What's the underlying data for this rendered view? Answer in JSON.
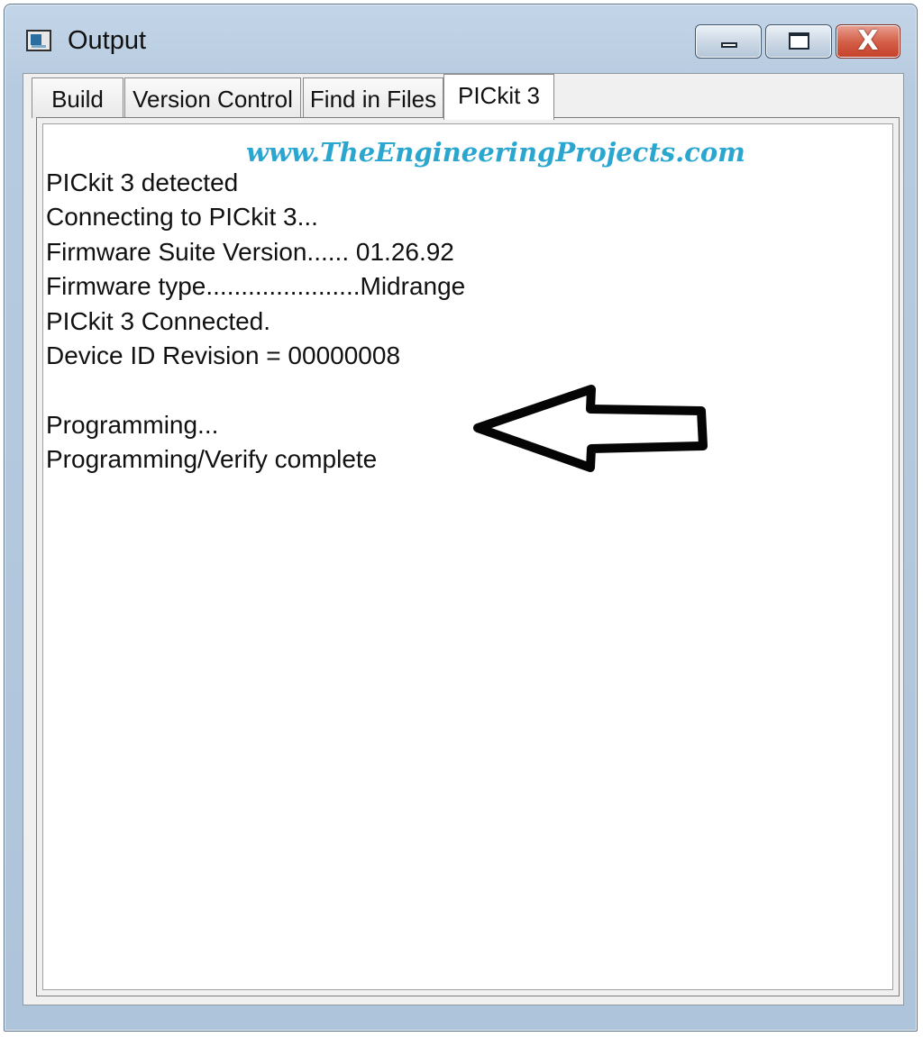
{
  "window": {
    "title": "Output",
    "icon": "output-window-icon"
  },
  "controls": {
    "minimize_icon": "minimize-icon",
    "maximize_icon": "maximize-icon",
    "close_glyph": "X"
  },
  "tabs": [
    {
      "label": "Build",
      "selected": false
    },
    {
      "label": "Version Control",
      "selected": false
    },
    {
      "label": "Find in Files",
      "selected": false
    },
    {
      "label": "PICkit 3",
      "selected": true
    }
  ],
  "content": {
    "watermark": "www.TheEngineeringProjects.com",
    "lines": [
      "PICkit 3 detected",
      "Connecting to PICkit 3...",
      "Firmware Suite Version...... 01.26.92",
      "Firmware type......................Midrange",
      "PICkit 3 Connected.",
      "Device ID Revision = 00000008",
      "",
      "Programming...",
      "Programming/Verify complete"
    ],
    "annotation_icon": "left-arrow-icon"
  },
  "colors": {
    "watermark": "#2aa6cf",
    "titlebar": "#b7cbe0",
    "close_button": "#c63f28"
  }
}
